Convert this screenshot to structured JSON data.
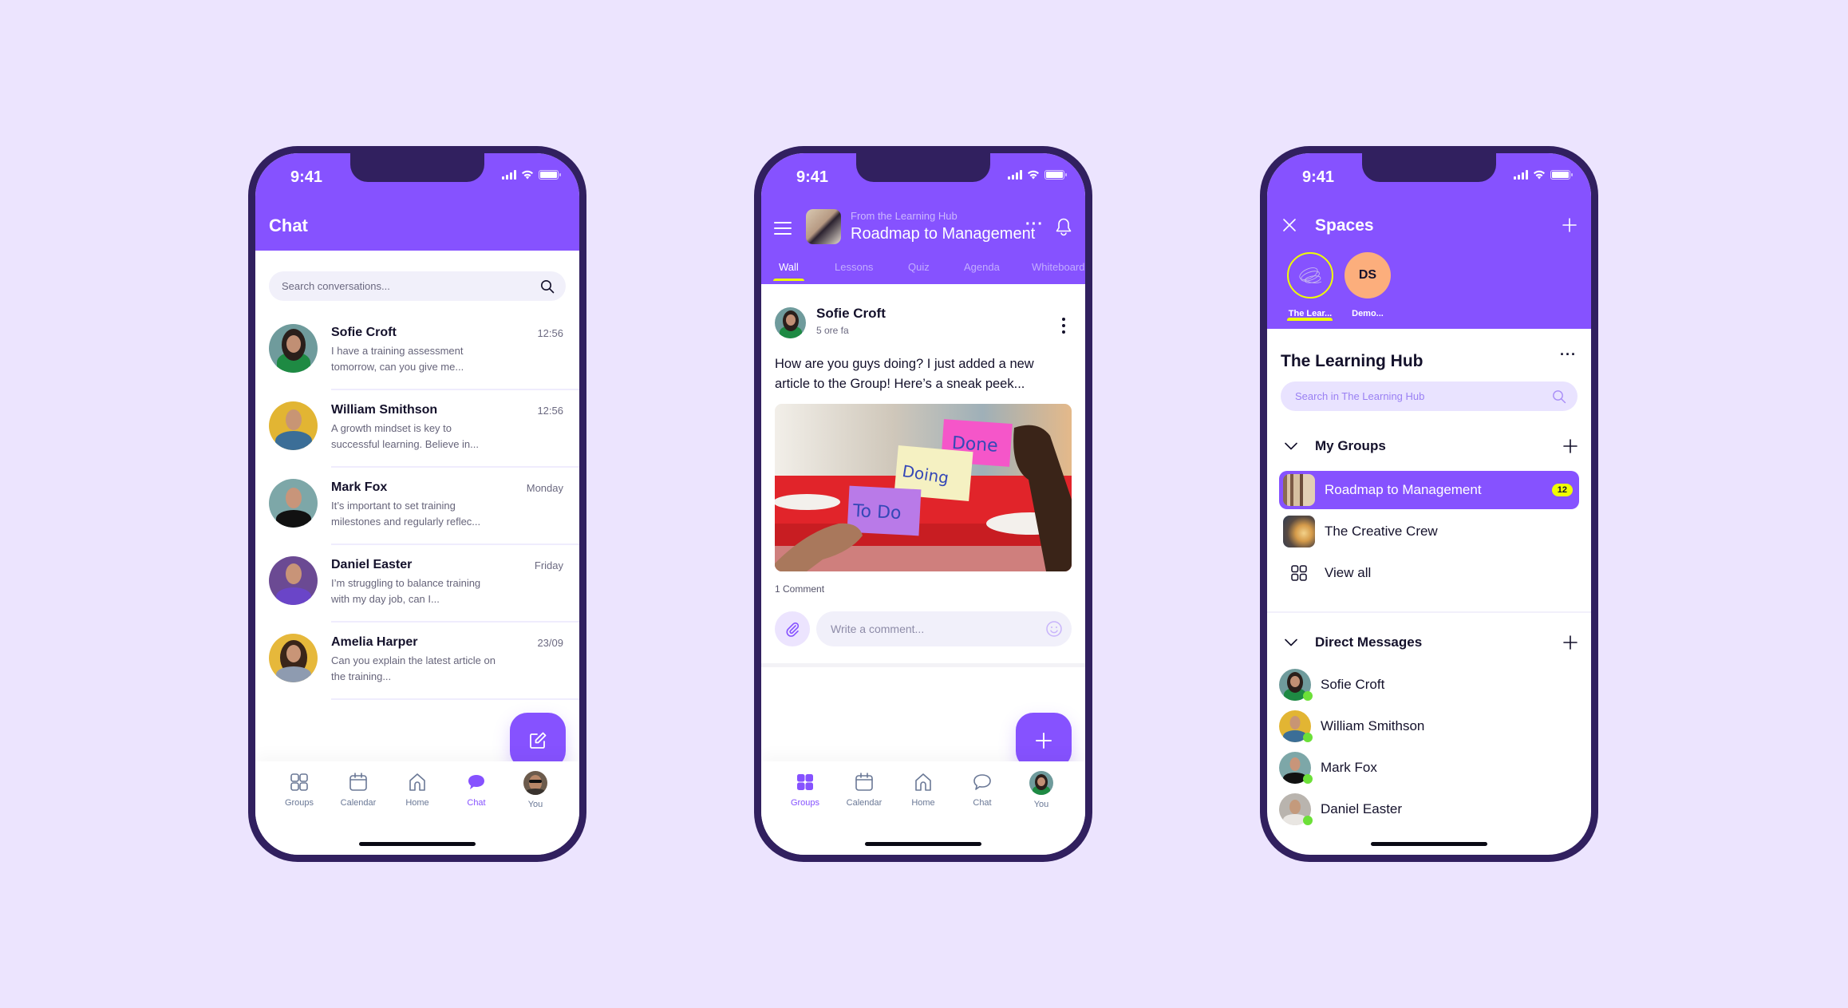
{
  "status_time": "9:41",
  "colors": {
    "background": "#ece4fe",
    "brand_purple": "#8652ff",
    "frame": "#31205f",
    "accent_yellow": "#f0ff00",
    "online_green": "#6ce038",
    "ds_avatar": "#fcae7c"
  },
  "nav": {
    "items": [
      {
        "label": "Groups",
        "icon": "grid-icon"
      },
      {
        "label": "Calendar",
        "icon": "calendar-icon"
      },
      {
        "label": "Home",
        "icon": "home-icon"
      },
      {
        "label": "Chat",
        "icon": "chat-bubble-icon"
      },
      {
        "label": "You",
        "icon": "profile-avatar"
      }
    ]
  },
  "chat_screen": {
    "title": "Chat",
    "search_placeholder": "Search conversations...",
    "active_nav": "Chat",
    "conversations": [
      {
        "name": "Sofie Croft",
        "message": "I have a training assessment tomorrow, can you give me...",
        "time": "12:56"
      },
      {
        "name": "William Smithson",
        "message": "A growth mindset is key to successful learning. Believe in...",
        "time": "12:56"
      },
      {
        "name": "Mark Fox",
        "message": "It’s important to set training milestones and regularly reflec...",
        "time": "Monday"
      },
      {
        "name": "Daniel Easter",
        "message": "I’m struggling to balance training with my day job, can I...",
        "time": "Friday"
      },
      {
        "name": "Amelia Harper",
        "message": "Can you explain the latest article on the training...",
        "time": "23/09"
      }
    ],
    "fab_icon": "compose-icon"
  },
  "group_screen": {
    "subtitle": "From the Learning Hub",
    "title": "Roadmap to Management",
    "tabs": [
      "Wall",
      "Lessons",
      "Quiz",
      "Agenda",
      "Whiteboard"
    ],
    "active_tab": "Wall",
    "active_nav": "Groups",
    "post": {
      "author": "Sofie Croft",
      "time": "5 ore fa",
      "text": "How are you guys doing? I just added a new article to the Group! Here’s a sneak peek...",
      "image_notes": [
        "Done",
        "Doing",
        "To Do"
      ],
      "comment_count": "1 Comment",
      "comment_placeholder": "Write a comment..."
    },
    "fab_icon": "plus-icon"
  },
  "spaces_screen": {
    "title": "Spaces",
    "spaces": [
      {
        "label": "The Lear...",
        "initials": ""
      },
      {
        "label": "Demo...",
        "initials": "DS"
      }
    ],
    "hub_title": "The Learning Hub",
    "hub_search_placeholder": "Search in The Learning Hub",
    "my_groups": {
      "label": "My Groups",
      "items": [
        {
          "label": "Roadmap to Management",
          "badge": "12",
          "active": true
        },
        {
          "label": "The Creative Crew",
          "badge": "",
          "active": false
        }
      ],
      "view_all": "View all"
    },
    "direct_messages": {
      "label": "Direct Messages",
      "items": [
        {
          "name": "Sofie Croft",
          "online": true
        },
        {
          "name": "William Smithson",
          "online": true
        },
        {
          "name": "Mark Fox",
          "online": true
        },
        {
          "name": "Daniel Easter",
          "online": true
        }
      ]
    }
  }
}
